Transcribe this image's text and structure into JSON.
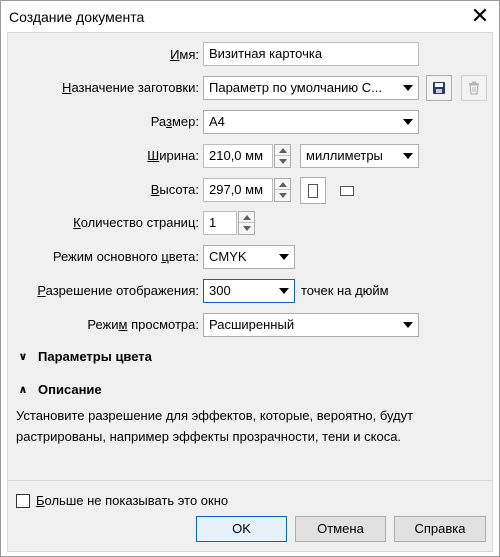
{
  "window": {
    "title": "Создание документа",
    "close_glyph": "✕"
  },
  "form": {
    "name": {
      "label": "Имя:",
      "underline": "И",
      "value": "Визитная карточка"
    },
    "preset": {
      "label": "Назначение заготовки:",
      "underline": "Н",
      "value": "Параметр по умолчанию С..."
    },
    "size": {
      "label": "Размер:",
      "underline": "з",
      "value": "A4"
    },
    "width": {
      "label": "Ширина:",
      "underline": "Ш",
      "value": "210,0 мм",
      "unit": "миллиметры"
    },
    "height": {
      "label": "Высота:",
      "underline": "В",
      "value": "297,0 мм"
    },
    "pages": {
      "label": "Количество страниц:",
      "underline": "К",
      "value": "1"
    },
    "color_mode": {
      "label": "Режим основного цвета:",
      "underline": "ц",
      "value": "CMYK"
    },
    "resolution": {
      "label": "Разрешение отображения:",
      "underline": "Р",
      "value": "300",
      "suffix": "точек на дюйм"
    },
    "view_mode": {
      "label": "Режим просмотра:",
      "underline": "м",
      "value": "Расширенный"
    }
  },
  "sections": {
    "color_settings": {
      "title": "Параметры цвета",
      "state": "collapsed"
    },
    "description": {
      "title": "Описание",
      "state": "expanded",
      "text": "Установите разрешение для эффектов, которые, вероятно, будут растрированы, например эффекты прозрачности, тени и скоса."
    }
  },
  "footer": {
    "dont_show": {
      "label": "Больше не показывать это окно",
      "underline": "Б",
      "checked": false
    },
    "ok": "OK",
    "cancel": "Отмена",
    "help": "Справка"
  },
  "icons": {
    "save_preset": "save-icon",
    "delete_preset": "trash-icon",
    "portrait": "portrait-orientation-icon",
    "landscape": "landscape-orientation-icon"
  },
  "colors": {
    "accent": "#0a64c8",
    "save_icon": "#2b3a67"
  }
}
